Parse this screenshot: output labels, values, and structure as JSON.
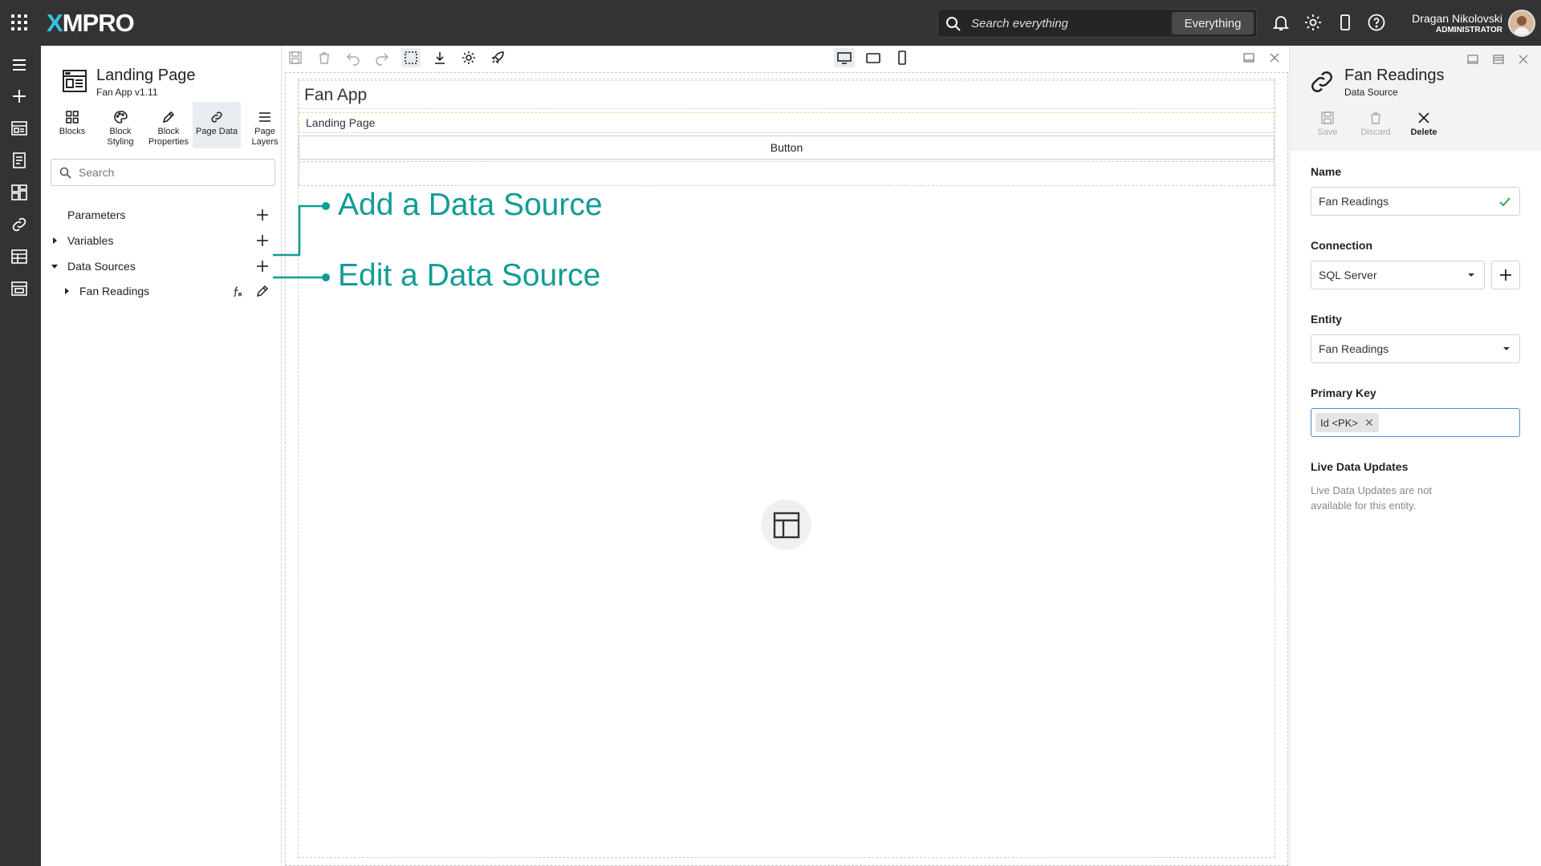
{
  "header": {
    "search_placeholder": "Search everything",
    "search_scope": "Everything",
    "user_name": "Dragan Nikolovski",
    "user_role": "ADMINISTRATOR",
    "icons": [
      "apps-grid-icon",
      "search-icon",
      "bell-icon",
      "gear-icon",
      "device-icon",
      "help-icon"
    ]
  },
  "rail": {
    "icons": [
      "hamburger-icon",
      "plus-icon",
      "apps-icon",
      "document-icon",
      "dashboard-icon",
      "link-icon",
      "table-icon",
      "screen-icon"
    ]
  },
  "left_panel": {
    "page_title": "Landing Page",
    "page_subtitle": "Fan App v1.11",
    "tabs": [
      {
        "label": "Blocks",
        "icon": "blocks-icon",
        "active": false
      },
      {
        "label": "Block Styling",
        "icon": "palette-icon",
        "active": false
      },
      {
        "label": "Block Properties",
        "icon": "pencil-icon",
        "active": false
      },
      {
        "label": "Page Data",
        "icon": "link-icon",
        "active": true
      },
      {
        "label": "Page Layers",
        "icon": "layers-icon",
        "active": false
      }
    ],
    "search_placeholder": "Search",
    "tree": {
      "parameters": "Parameters",
      "variables": "Variables",
      "data_sources": "Data Sources",
      "fan_readings": "Fan Readings"
    }
  },
  "canvas": {
    "app_title": "Fan App",
    "page_label": "Landing Page",
    "button_label": "Button",
    "callout_add": "Add a Data Source",
    "callout_edit": "Edit a Data Source",
    "accent_color": "#119c95"
  },
  "right_panel": {
    "title": "Fan Readings",
    "subtitle": "Data Source",
    "actions": [
      {
        "label": "Save",
        "enabled": false
      },
      {
        "label": "Discard",
        "enabled": false
      },
      {
        "label": "Delete",
        "enabled": true
      }
    ],
    "name_label": "Name",
    "name_value": "Fan Readings",
    "connection_label": "Connection",
    "connection_value": "SQL Server",
    "entity_label": "Entity",
    "entity_value": "Fan Readings",
    "primary_key_label": "Primary Key",
    "primary_key_tag": "Id <PK>",
    "live_label": "Live Data Updates",
    "live_desc": "Live Data Updates are not available for this entity."
  }
}
